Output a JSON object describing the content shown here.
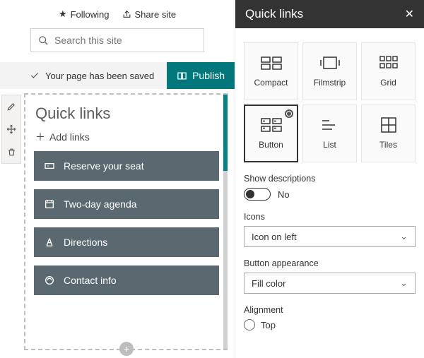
{
  "top": {
    "following": "Following",
    "share": "Share site"
  },
  "search": {
    "placeholder": "Search this site"
  },
  "notify": {
    "msg": "Your page has been saved",
    "publish": "Publish"
  },
  "editor": {
    "title": "Quick links",
    "add": "Add links",
    "items": [
      {
        "label": "Reserve your seat"
      },
      {
        "label": "Two-day agenda"
      },
      {
        "label": "Directions"
      },
      {
        "label": "Contact info"
      }
    ]
  },
  "panel": {
    "title": "Quick links",
    "layouts": [
      {
        "label": "Compact"
      },
      {
        "label": "Filmstrip"
      },
      {
        "label": "Grid"
      },
      {
        "label": "Button",
        "selected": true
      },
      {
        "label": "List"
      },
      {
        "label": "Tiles"
      }
    ],
    "show_desc_label": "Show descriptions",
    "show_desc_value": "No",
    "icons_label": "Icons",
    "icons_value": "Icon on left",
    "appearance_label": "Button appearance",
    "appearance_value": "Fill color",
    "alignment_label": "Alignment",
    "alignment_value": "Top"
  }
}
